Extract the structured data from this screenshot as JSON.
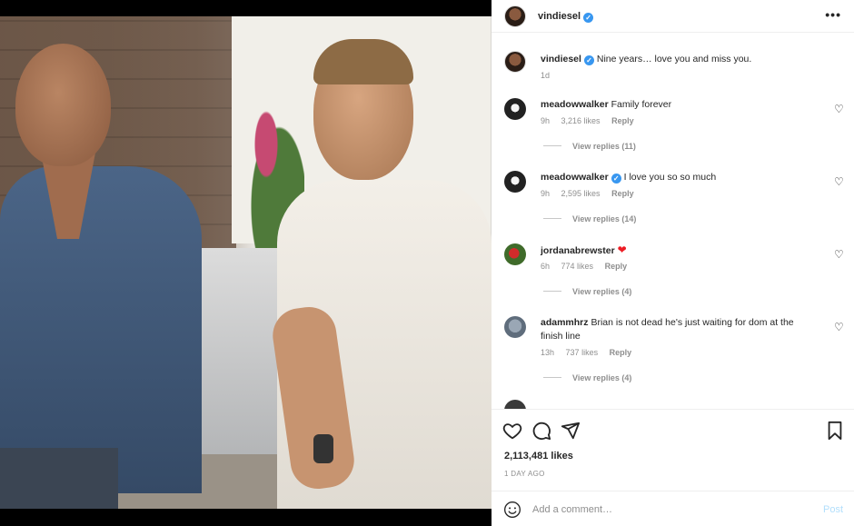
{
  "post": {
    "image_alt": "",
    "author": {
      "username": "vindiesel",
      "verified": true
    },
    "caption": {
      "username": "vindiesel",
      "text": "Nine years… love you and miss you.",
      "time": "1d"
    },
    "comments": [
      {
        "username": "meadowwalker",
        "verified": false,
        "text": "Family forever",
        "time": "9h",
        "likes": "3,216 likes",
        "reply": "Reply",
        "view_replies": "View replies (11)"
      },
      {
        "username": "meadowwalker",
        "verified": true,
        "text": "I love you so so much",
        "time": "9h",
        "likes": "2,595 likes",
        "reply": "Reply",
        "view_replies": "View replies (14)"
      },
      {
        "username": "jordanabrewster",
        "verified": false,
        "text": "",
        "emoji": "❤",
        "time": "6h",
        "likes": "774 likes",
        "reply": "Reply",
        "view_replies": "View replies (4)"
      },
      {
        "username": "adammhrz",
        "verified": false,
        "text": "Brian is not dead he's just waiting for dom at the finish line",
        "time": "13h",
        "likes": "737 likes",
        "reply": "Reply",
        "view_replies": "View replies (4)"
      }
    ],
    "likes_count": "2,113,481 likes",
    "posted_ago": "1 DAY AGO",
    "add_comment_placeholder": "Add a comment…",
    "post_button": "Post",
    "more_icon": "more-options-icon"
  },
  "colors": {
    "verified": "#3897f0",
    "post_button": "#b2dffc",
    "heart_red": "#ed1c24"
  }
}
